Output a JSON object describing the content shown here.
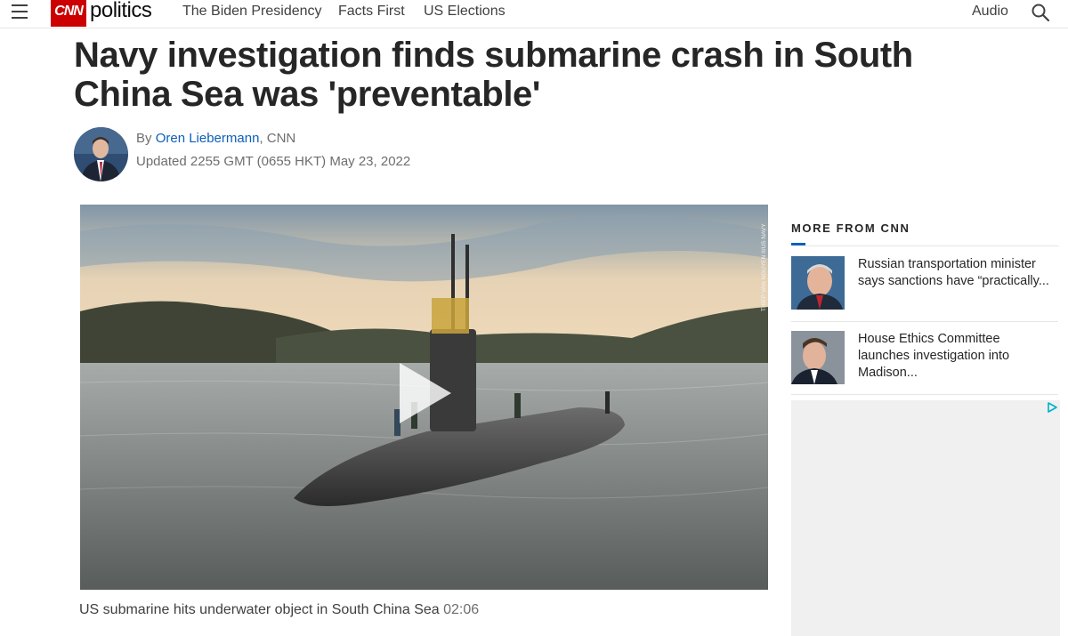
{
  "header": {
    "logo_text": "CNN",
    "section": "politics",
    "nav": [
      "The Biden Presidency",
      "Facts First",
      "US Elections"
    ],
    "audio": "Audio"
  },
  "article": {
    "headline": "Navy investigation finds submarine crash in South China Sea was 'preventable'",
    "by_prefix": "By",
    "author": "Oren Liebermann",
    "outlet": ", CNN",
    "updated": "Updated 2255 GMT (0655 HKT) May 23, 2022"
  },
  "video": {
    "credit": "THIEP VAN NGUYEN II/US NAVY",
    "caption": "US submarine hits underwater object in South China Sea",
    "duration": "02:06"
  },
  "sidebar": {
    "title": "MORE FROM CNN",
    "stories": [
      {
        "title": "Russian transportation minister says sanctions have “practically..."
      },
      {
        "title": "House Ethics Committee launches investigation into Madison..."
      }
    ]
  },
  "colors": {
    "brand_red": "#cc0000",
    "link_blue": "#0c5fb9",
    "ad_icon": "#00aecd"
  },
  "icons": [
    "menu-icon",
    "search-icon",
    "play-icon",
    "adchoices-icon"
  ]
}
